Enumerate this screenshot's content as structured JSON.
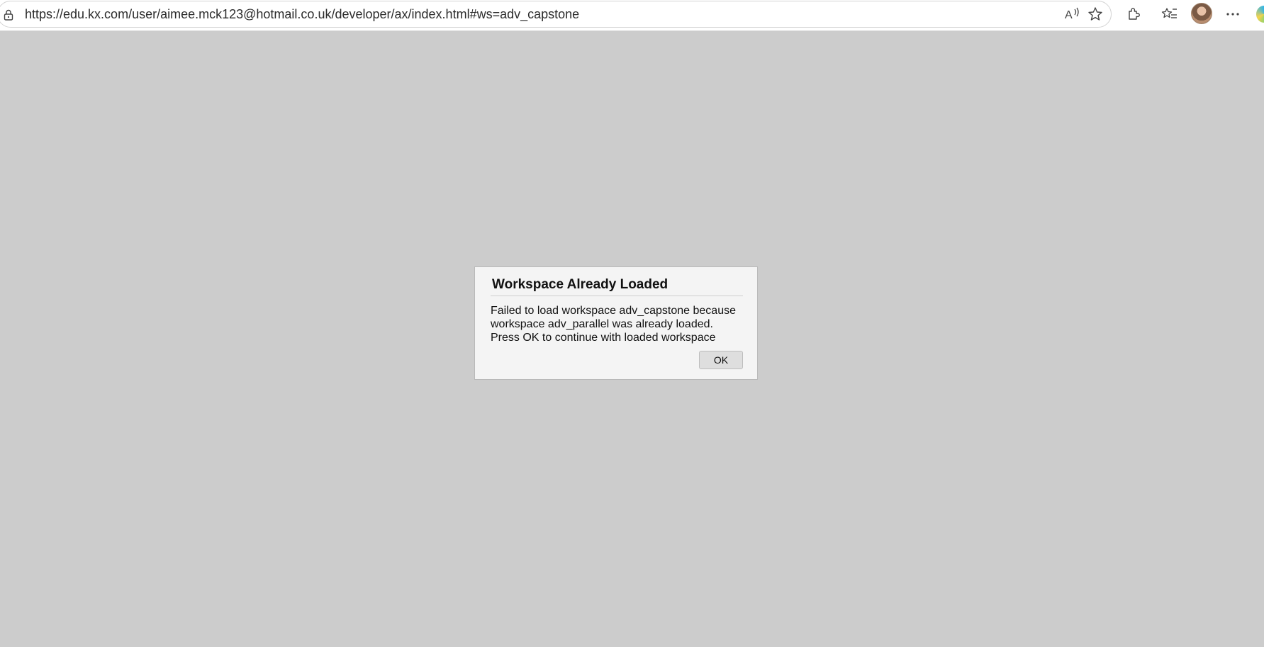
{
  "browser": {
    "url": "https://edu.kx.com/user/aimee.mck123@hotmail.co.uk/developer/ax/index.html#ws=adv_capstone",
    "icons": [
      "lock-icon",
      "read-aloud-icon",
      "favorite-star-icon",
      "extensions-icon",
      "favorites-icon",
      "profile-avatar",
      "more-menu-icon",
      "edge-copilot-icon"
    ]
  },
  "dialog": {
    "title": "Workspace Already Loaded",
    "message_lines": [
      "Failed to load workspace adv_capstone because",
      "workspace adv_parallel was already loaded.",
      "Press OK to continue with loaded workspace"
    ],
    "ok_label": "OK"
  },
  "colors": {
    "page_background": "#cccccc",
    "dialog_background": "#f4f4f4",
    "button_background": "#dedede"
  }
}
